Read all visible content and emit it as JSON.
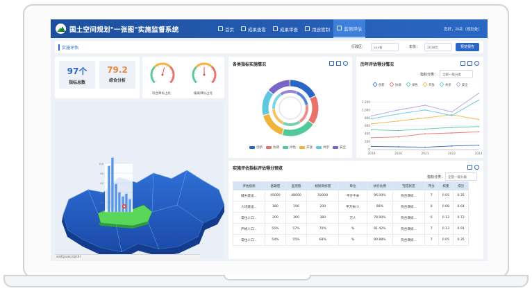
{
  "app": {
    "title": "国土空间规划\"一张图\"实施监督系统",
    "user": "您好，孙兵（规划处）",
    "nav": [
      {
        "label": "首页",
        "icon": "home-icon",
        "active": false
      },
      {
        "label": "成果查看",
        "icon": "person-icon",
        "active": false
      },
      {
        "label": "成果审查",
        "icon": "review-icon",
        "active": false
      },
      {
        "label": "用途管制",
        "icon": "control-icon",
        "active": false
      },
      {
        "label": "监测评估",
        "icon": "monitor-icon",
        "active": true
      }
    ]
  },
  "toolbar": {
    "section": "实施评估",
    "region_label": "行政区：",
    "region_value": "xxx省",
    "year_label": "年份：",
    "year_value": "2018年",
    "report_button": "预览报告"
  },
  "kpis": [
    {
      "value": "97个",
      "label": "指标总数",
      "color": "#2a67c4"
    },
    {
      "value": "79.2",
      "label": "综合分析",
      "color": "#e8873a"
    }
  ],
  "gauges": [
    {
      "label": "符合目标占比",
      "value": 0.55
    },
    {
      "label": "偏离目标占比",
      "value": 0.5
    }
  ],
  "donut_panel": {
    "title": "各类指标实施情况",
    "legend": [
      {
        "name": "创新",
        "color": "#2a67c4"
      },
      {
        "name": "协调",
        "color": "#e8736a"
      },
      {
        "name": "绿色",
        "color": "#52c99a"
      },
      {
        "name": "开放",
        "color": "#f0b43c"
      },
      {
        "name": "共享",
        "color": "#5ec8e0"
      },
      {
        "name": "安全",
        "color": "#7a64c8"
      }
    ]
  },
  "chart_data": {
    "type": "line",
    "title": "历年评估得分情况",
    "filter_label": "指标分类：",
    "filter_value": "全部一级分类",
    "x": [
      2019,
      2020,
      2021,
      2022,
      2023
    ],
    "ylim": [
      0,
      1400
    ],
    "yticks": [
      0,
      200,
      400,
      600,
      800,
      1000,
      1200
    ],
    "grid": true,
    "legend_position": "top",
    "series": [
      {
        "name": "创新",
        "color": "#2a67c4",
        "values": [
          80,
          70,
          60,
          90,
          110
        ]
      },
      {
        "name": "协调",
        "color": "#e8736a",
        "values": [
          300,
          320,
          400,
          420,
          450
        ]
      },
      {
        "name": "绿色",
        "color": "#52c99a",
        "values": [
          500,
          480,
          520,
          560,
          580
        ]
      },
      {
        "name": "开放",
        "color": "#f0b43c",
        "values": [
          650,
          720,
          800,
          880,
          760
        ]
      },
      {
        "name": "共享",
        "color": "#5ec8e0",
        "values": [
          780,
          900,
          1000,
          860,
          1250
        ]
      },
      {
        "name": "安全",
        "color": "#b49ee0",
        "values": [
          850,
          1000,
          1120,
          950,
          1420
        ]
      }
    ]
  },
  "table_panel": {
    "title": "实施评估指标评估得分预览",
    "filter_label": "指标分类：",
    "filter_value": "全部一级分类",
    "headers": [
      "评估指标",
      "基期值",
      "监测值",
      "规划目标值",
      "单位",
      "执行比例",
      "完成状态",
      "评分",
      "权重",
      "得分"
    ],
    "rows": [
      [
        "城乡建设...",
        "45000",
        "48000",
        "50000",
        "平方千米",
        "96.00%",
        "符合目标...",
        "7",
        "0.05",
        "0.35"
      ],
      [
        "人均建设...",
        "180",
        "196",
        "200",
        "平方米/人",
        "98%",
        "符合目标...",
        "8",
        "0.08",
        "0.64"
      ],
      [
        "常住人口...",
        "200",
        "300",
        "380",
        "万人",
        "78.90%",
        "符合目标...",
        "6",
        "0.12",
        "0.72"
      ],
      [
        "严格人口...",
        "55%",
        "57%",
        "70%",
        "%",
        "81.42%",
        "符合目标...",
        "7",
        "0.13",
        "0.91"
      ],
      [
        "常住人口...",
        "54%",
        "55%",
        "68%",
        "%",
        "80.88%",
        "符合目标...",
        "7",
        "0.05",
        "0.35"
      ]
    ]
  },
  "status_text": "void(javascript:0)"
}
